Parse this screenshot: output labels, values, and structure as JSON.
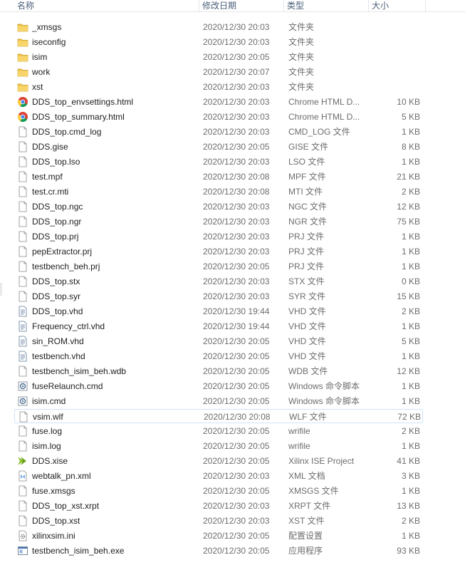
{
  "header": {
    "name": "名称",
    "date": "修改日期",
    "type": "类型",
    "size": "大小"
  },
  "files": [
    {
      "name": "_xmsgs",
      "date": "2020/12/30 20:03",
      "type": "文件夹",
      "size": "",
      "icon": "folder-icon"
    },
    {
      "name": "iseconfig",
      "date": "2020/12/30 20:03",
      "type": "文件夹",
      "size": "",
      "icon": "folder-icon"
    },
    {
      "name": "isim",
      "date": "2020/12/30 20:05",
      "type": "文件夹",
      "size": "",
      "icon": "folder-icon"
    },
    {
      "name": "work",
      "date": "2020/12/30 20:07",
      "type": "文件夹",
      "size": "",
      "icon": "folder-icon"
    },
    {
      "name": "xst",
      "date": "2020/12/30 20:03",
      "type": "文件夹",
      "size": "",
      "icon": "folder-icon"
    },
    {
      "name": "DDS_top_envsettings.html",
      "date": "2020/12/30 20:03",
      "type": "Chrome HTML D...",
      "size": "10 KB",
      "icon": "chrome-icon"
    },
    {
      "name": "DDS_top_summary.html",
      "date": "2020/12/30 20:03",
      "type": "Chrome HTML D...",
      "size": "5 KB",
      "icon": "chrome-icon"
    },
    {
      "name": "DDS_top.cmd_log",
      "date": "2020/12/30 20:03",
      "type": "CMD_LOG 文件",
      "size": "1 KB",
      "icon": "file-icon"
    },
    {
      "name": "DDS.gise",
      "date": "2020/12/30 20:05",
      "type": "GISE 文件",
      "size": "8 KB",
      "icon": "file-icon"
    },
    {
      "name": "DDS_top.lso",
      "date": "2020/12/30 20:03",
      "type": "LSO 文件",
      "size": "1 KB",
      "icon": "file-icon"
    },
    {
      "name": "test.mpf",
      "date": "2020/12/30 20:08",
      "type": "MPF 文件",
      "size": "21 KB",
      "icon": "file-icon"
    },
    {
      "name": "test.cr.mti",
      "date": "2020/12/30 20:08",
      "type": "MTI 文件",
      "size": "2 KB",
      "icon": "file-icon"
    },
    {
      "name": "DDS_top.ngc",
      "date": "2020/12/30 20:03",
      "type": "NGC 文件",
      "size": "12 KB",
      "icon": "file-icon"
    },
    {
      "name": "DDS_top.ngr",
      "date": "2020/12/30 20:03",
      "type": "NGR 文件",
      "size": "75 KB",
      "icon": "file-icon"
    },
    {
      "name": "DDS_top.prj",
      "date": "2020/12/30 20:03",
      "type": "PRJ 文件",
      "size": "1 KB",
      "icon": "file-icon"
    },
    {
      "name": "pepExtractor.prj",
      "date": "2020/12/30 20:03",
      "type": "PRJ 文件",
      "size": "1 KB",
      "icon": "file-icon"
    },
    {
      "name": "testbench_beh.prj",
      "date": "2020/12/30 20:05",
      "type": "PRJ 文件",
      "size": "1 KB",
      "icon": "file-icon"
    },
    {
      "name": "DDS_top.stx",
      "date": "2020/12/30 20:03",
      "type": "STX 文件",
      "size": "0 KB",
      "icon": "file-icon"
    },
    {
      "name": "DDS_top.syr",
      "date": "2020/12/30 20:03",
      "type": "SYR 文件",
      "size": "15 KB",
      "icon": "file-icon"
    },
    {
      "name": "DDS_top.vhd",
      "date": "2020/12/30 19:44",
      "type": "VHD 文件",
      "size": "2 KB",
      "icon": "text-file-icon"
    },
    {
      "name": "Frequency_ctrl.vhd",
      "date": "2020/12/30 19:44",
      "type": "VHD 文件",
      "size": "1 KB",
      "icon": "text-file-icon"
    },
    {
      "name": "sin_ROM.vhd",
      "date": "2020/12/30 20:05",
      "type": "VHD 文件",
      "size": "5 KB",
      "icon": "text-file-icon"
    },
    {
      "name": "testbench.vhd",
      "date": "2020/12/30 20:05",
      "type": "VHD 文件",
      "size": "1 KB",
      "icon": "text-file-icon"
    },
    {
      "name": "testbench_isim_beh.wdb",
      "date": "2020/12/30 20:05",
      "type": "WDB 文件",
      "size": "12 KB",
      "icon": "file-icon"
    },
    {
      "name": "fuseRelaunch.cmd",
      "date": "2020/12/30 20:05",
      "type": "Windows 命令脚本",
      "size": "1 KB",
      "icon": "script-icon"
    },
    {
      "name": "isim.cmd",
      "date": "2020/12/30 20:05",
      "type": "Windows 命令脚本",
      "size": "1 KB",
      "icon": "script-icon"
    },
    {
      "name": "vsim.wlf",
      "date": "2020/12/30 20:08",
      "type": "WLF 文件",
      "size": "72 KB",
      "icon": "file-icon",
      "selected": true
    },
    {
      "name": "fuse.log",
      "date": "2020/12/30 20:05",
      "type": "wrifile",
      "size": "2 KB",
      "icon": "file-icon"
    },
    {
      "name": "isim.log",
      "date": "2020/12/30 20:05",
      "type": "wrifile",
      "size": "1 KB",
      "icon": "file-icon"
    },
    {
      "name": "DDS.xise",
      "date": "2020/12/30 20:05",
      "type": "Xilinx ISE Project",
      "size": "41 KB",
      "icon": "xilinx-icon"
    },
    {
      "name": "webtalk_pn.xml",
      "date": "2020/12/30 20:03",
      "type": "XML 文档",
      "size": "3 KB",
      "icon": "xml-icon"
    },
    {
      "name": "fuse.xmsgs",
      "date": "2020/12/30 20:05",
      "type": "XMSGS 文件",
      "size": "1 KB",
      "icon": "file-icon"
    },
    {
      "name": "DDS_top_xst.xrpt",
      "date": "2020/12/30 20:03",
      "type": "XRPT 文件",
      "size": "13 KB",
      "icon": "file-icon"
    },
    {
      "name": "DDS_top.xst",
      "date": "2020/12/30 20:03",
      "type": "XST 文件",
      "size": "2 KB",
      "icon": "file-icon"
    },
    {
      "name": "xilinxsim.ini",
      "date": "2020/12/30 20:05",
      "type": "配置设置",
      "size": "1 KB",
      "icon": "ini-icon"
    },
    {
      "name": "testbench_isim_beh.exe",
      "date": "2020/12/30 20:05",
      "type": "应用程序",
      "size": "93 KB",
      "icon": "exe-icon"
    }
  ]
}
